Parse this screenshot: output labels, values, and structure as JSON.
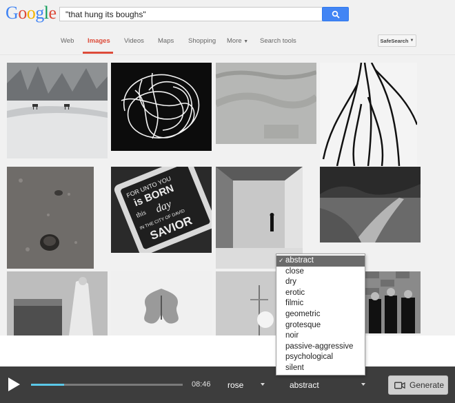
{
  "search": {
    "logo": [
      "G",
      "o",
      "o",
      "g",
      "l",
      "e"
    ],
    "logo_colors": [
      "#4285f4",
      "#dd4b39",
      "#f4b400",
      "#4285f4",
      "#0f9d58",
      "#dd4b39"
    ],
    "query": "\"that hung its boughs\"",
    "button_icon": "magnifier-icon"
  },
  "nav": {
    "items": [
      "Web",
      "Images",
      "Videos",
      "Maps",
      "Shopping",
      "More",
      "Search tools"
    ],
    "active": "Images",
    "safesearch_label": "SafeSearch"
  },
  "images": [
    {
      "subject": "snowy field with deer",
      "icon": "photo"
    },
    {
      "subject": "abstract wire scribble",
      "icon": "photo"
    },
    {
      "subject": "foggy grey landscape",
      "icon": "photo"
    },
    {
      "subject": "black branching lines",
      "icon": "photo"
    },
    {
      "subject": "pine cone on dirt ground",
      "icon": "photo"
    },
    {
      "subject": "chalkboard sign",
      "icon": "photo"
    },
    {
      "subject": "figure in empty room",
      "icon": "photo"
    },
    {
      "subject": "dirt road through trees",
      "icon": "photo"
    },
    {
      "subject": "victorian woman with chest",
      "icon": "photo"
    },
    {
      "subject": "ink blot",
      "icon": "photo"
    },
    {
      "subject": "misty pole",
      "icon": "photo"
    },
    {
      "subject": "band portrait",
      "icon": "photo"
    }
  ],
  "chalkboard_text": [
    "FOR UNTO YOU",
    "is BORN",
    "this",
    "day",
    "IN THE CITY OF DAVID",
    "SAVIOR"
  ],
  "player": {
    "time": "08:46",
    "progress": 0.22,
    "select_1": "rose",
    "select_2": "abstract",
    "generate_label": "Generate"
  },
  "dropdown": {
    "selected": "abstract",
    "options": [
      "abstract",
      "close",
      "dry",
      "erotic",
      "filmic",
      "geometric",
      "grotesque",
      "noir",
      "passive-aggressive",
      "psychological",
      "silent"
    ]
  }
}
